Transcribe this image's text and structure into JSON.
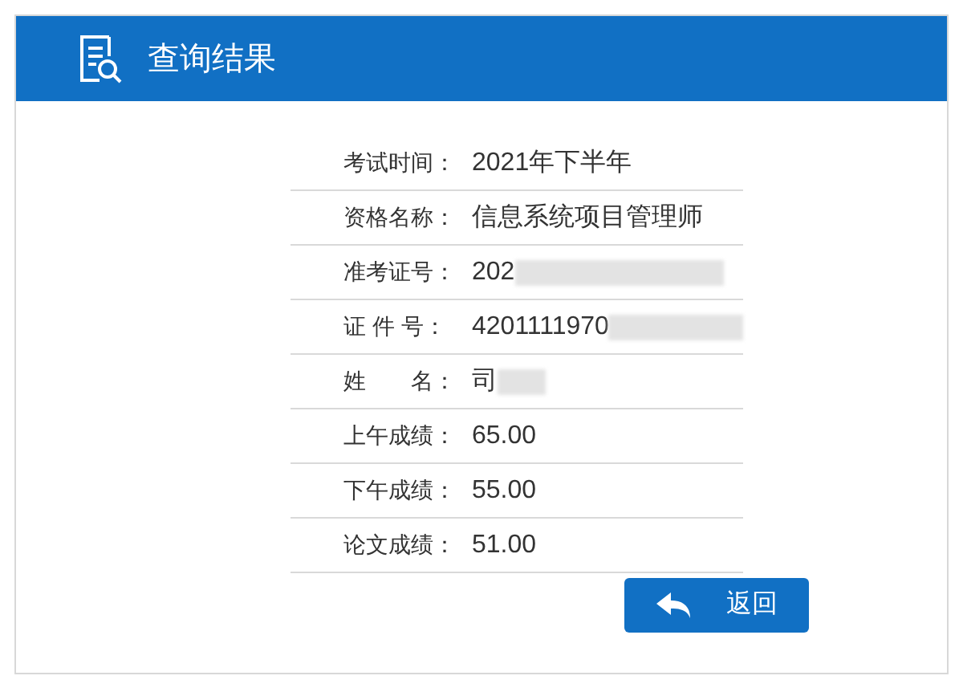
{
  "header": {
    "title": "查询结果"
  },
  "rows": [
    {
      "label": "考试时间：",
      "value": "2021年下半年",
      "blurred": false
    },
    {
      "label": "资格名称：",
      "value": "信息系统项目管理师",
      "blurred": false
    },
    {
      "label": "准考证号：",
      "value": "202",
      "blurred": true
    },
    {
      "label": "证 件 号：",
      "value": "4201111970",
      "blurred": true
    },
    {
      "label": "姓　　名：",
      "value": "司",
      "blurred": true
    },
    {
      "label": "上午成绩：",
      "value": "65.00",
      "blurred": false
    },
    {
      "label": "下午成绩：",
      "value": "55.00",
      "blurred": false
    },
    {
      "label": "论文成绩：",
      "value": "51.00",
      "blurred": false
    }
  ],
  "back_button": {
    "label": "返回"
  }
}
